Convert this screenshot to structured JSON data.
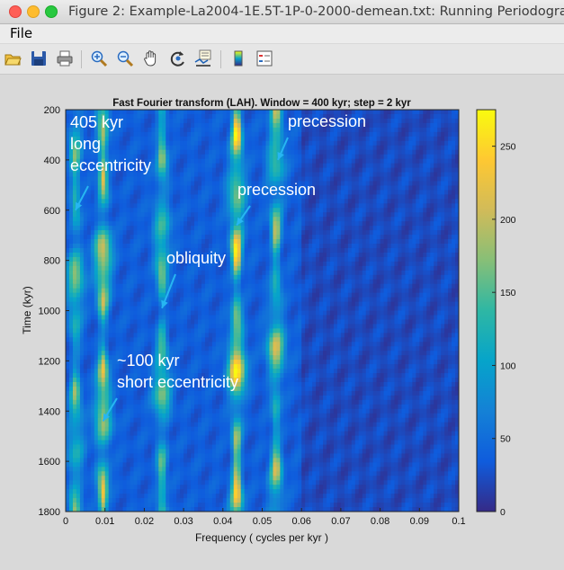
{
  "window": {
    "title": "Figure 2: Example-La2004-1E.5T-1P-0-2000-demean.txt: Running Periodogram"
  },
  "menu": {
    "file": "File"
  },
  "toolbar": {
    "icons": [
      "open-folder-icon",
      "save-icon",
      "print-icon",
      "zoom-in-icon",
      "zoom-out-icon",
      "pan-hand-icon",
      "rotate-icon",
      "data-cursor-icon",
      "colorbar-icon",
      "legend-icon"
    ]
  },
  "colors": {
    "colormap": [
      "#352a87",
      "#0f5cdd",
      "#1481d6",
      "#06a4ca",
      "#2eb7a4",
      "#87bf77",
      "#d1bb59",
      "#fec832",
      "#f9fb0e"
    ]
  },
  "chart_data": {
    "type": "heatmap",
    "title": "Fast Fourier transform (LAH). Window = 400 kyr; step = 2 kyr",
    "xlabel": "Frequency ( cycles per kyr )",
    "ylabel": "Time (kyr)",
    "xlim": [
      0,
      0.1
    ],
    "ylim": [
      200,
      1800
    ],
    "y_reversed": true,
    "x_ticks": [
      "0",
      "0.01",
      "0.02",
      "0.03",
      "0.04",
      "0.05",
      "0.06",
      "0.07",
      "0.08",
      "0.09",
      "0.1"
    ],
    "y_ticks": [
      "200",
      "400",
      "600",
      "800",
      "1000",
      "1200",
      "1400",
      "1600",
      "1800"
    ],
    "colorbar": {
      "min": 0,
      "max": 275,
      "ticks": [
        "0",
        "50",
        "100",
        "150",
        "200",
        "250"
      ]
    },
    "bands": [
      {
        "freq": 0.0025,
        "level": 150
      },
      {
        "freq": 0.0095,
        "level": 215
      },
      {
        "freq": 0.0245,
        "level": 160
      },
      {
        "freq": 0.0435,
        "level": 245
      },
      {
        "freq": 0.0535,
        "level": 175
      }
    ],
    "annotations": [
      {
        "text": [
          "405 kyr",
          "long",
          "eccentricity"
        ],
        "freq": 0.0025,
        "time": 600
      },
      {
        "text": [
          "precession"
        ],
        "freq": 0.054,
        "time": 400
      },
      {
        "text": [
          "precession"
        ],
        "freq": 0.0435,
        "time": 660
      },
      {
        "text": [
          "obliquity"
        ],
        "freq": 0.0245,
        "time": 990
      },
      {
        "text": [
          "~100 kyr",
          "short eccentricity"
        ],
        "freq": 0.0095,
        "time": 1440
      }
    ]
  }
}
